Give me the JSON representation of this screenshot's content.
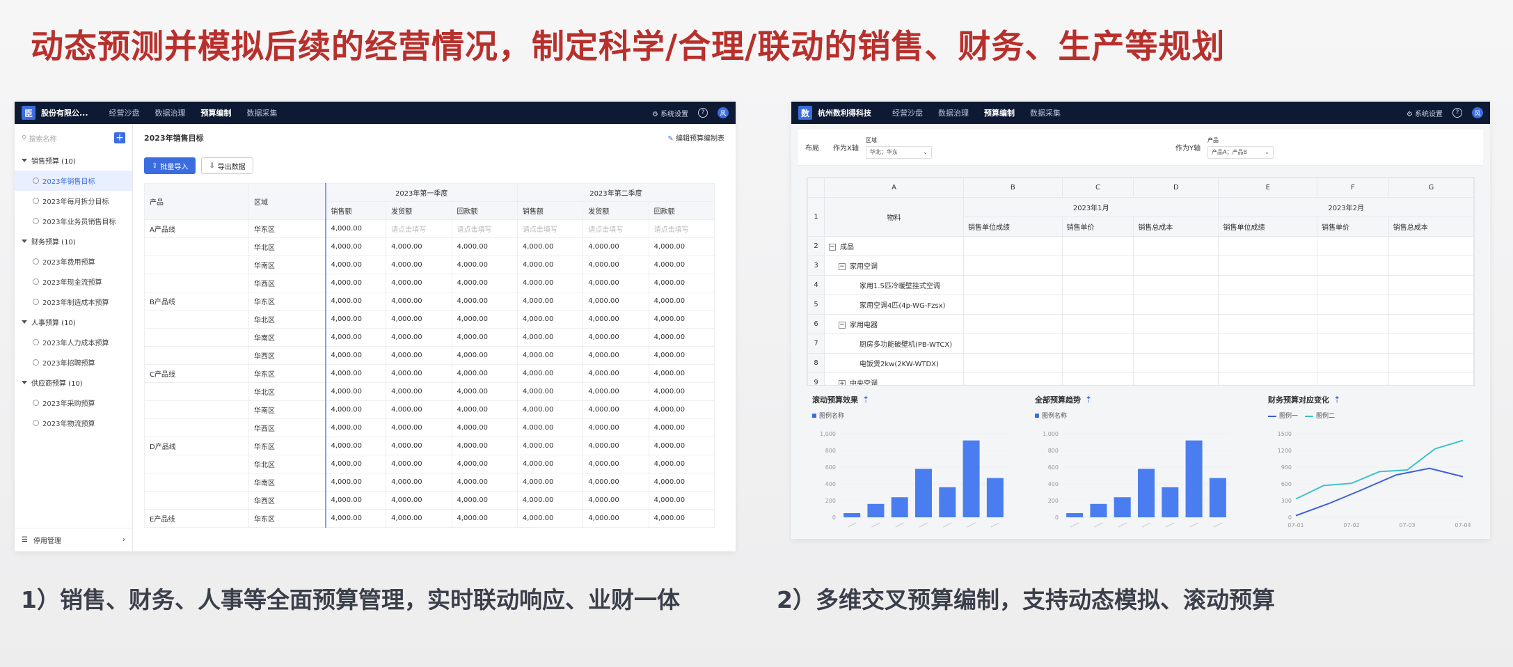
{
  "headline": "动态预测并模拟后续的经营情况，制定科学/合理/联动的销售、财务、生产等规划",
  "captions": {
    "left": "1）销售、财务、人事等全面预算管理，实时联动响应、业财一体",
    "right": "2）多维交叉预算编制，支持动态模拟、滚动预算"
  },
  "left": {
    "company": "股份有限公...",
    "nav": [
      "经营沙盘",
      "数据治理",
      "预算编制",
      "数据采集"
    ],
    "settings": "系统设置",
    "avatar": "风",
    "search": "搜索名称",
    "tree": [
      {
        "group": "销售预算 (10)",
        "items": [
          "2023年销售目标",
          "2023年每月拆分目标",
          "2023年业务员销售目标"
        ]
      },
      {
        "group": "财务预算 (10)",
        "items": [
          "2023年费用预算",
          "2023年现金流预算",
          "2023年制造成本预算"
        ]
      },
      {
        "group": "人事预算 (10)",
        "items": [
          "2023年人力成本预算",
          "2023年招聘预算"
        ]
      },
      {
        "group": "供应商预算 (10)",
        "items": [
          "2023年采购预算",
          "2023年物流预算"
        ]
      }
    ],
    "footer": "停用管理",
    "title": "2023年销售目标",
    "edit": "编辑预算编制表",
    "import": "批量导入",
    "export": "导出数据",
    "q1": "2023年第一季度",
    "q2": "2023年第二季度",
    "col_product": "产品",
    "col_region": "区域",
    "cols": [
      "销售额",
      "发货额",
      "回款额",
      "销售额",
      "发货额",
      "回款额"
    ],
    "placeholder": "请点击填写",
    "value": "4,000.00",
    "rows": [
      [
        "A产品线",
        "华东区"
      ],
      [
        "",
        "华北区"
      ],
      [
        "",
        "华南区"
      ],
      [
        "",
        "华西区"
      ],
      [
        "B产品线",
        "华东区"
      ],
      [
        "",
        "华北区"
      ],
      [
        "",
        "华南区"
      ],
      [
        "",
        "华西区"
      ],
      [
        "C产品线",
        "华东区"
      ],
      [
        "",
        "华北区"
      ],
      [
        "",
        "华南区"
      ],
      [
        "",
        "华西区"
      ],
      [
        "D产品线",
        "华东区"
      ],
      [
        "",
        "华北区"
      ],
      [
        "",
        "华南区"
      ],
      [
        "",
        "华西区"
      ],
      [
        "E产品线",
        "华东区"
      ]
    ]
  },
  "right": {
    "logo": "数",
    "company": "杭州数利得科技",
    "nav": [
      "经营沙盘",
      "数据治理",
      "预算编制",
      "数据采集"
    ],
    "settings": "系统设置",
    "avatar": "风",
    "layout": "布局",
    "x_axis": "作为X轴",
    "region": "区域",
    "region_val": "华北；华东",
    "y_axis": "作为Y轴",
    "product": "产品",
    "product_val": "产品A；产品B",
    "cols": [
      "A",
      "B",
      "C",
      "D",
      "E",
      "F",
      "G"
    ],
    "month1": "2023年1月",
    "month2": "2023年2月",
    "material": "物料",
    "subcols": [
      "销售单位成绩",
      "销售单价",
      "销售总成本",
      "销售单位成绩",
      "销售单价",
      "销售总成本"
    ],
    "rows": [
      {
        "n": "2",
        "label": "成品",
        "level": 0,
        "box": "−"
      },
      {
        "n": "3",
        "label": "家用空调",
        "level": 1,
        "box": "−"
      },
      {
        "n": "4",
        "label": "家用1.5匹冷暖壁挂式空调",
        "level": 2,
        "box": ""
      },
      {
        "n": "5",
        "label": "家用空调4匹(4p-WG-Fzsx)",
        "level": 2,
        "box": ""
      },
      {
        "n": "6",
        "label": "家用电器",
        "level": 1,
        "box": "−"
      },
      {
        "n": "7",
        "label": "厨房多功能破壁机(PB-WTCX)",
        "level": 2,
        "box": ""
      },
      {
        "n": "8",
        "label": "电饭煲2kw(2KW-WTDX)",
        "level": 2,
        "box": ""
      },
      {
        "n": "9",
        "label": "中央空调",
        "level": 1,
        "box": "+"
      }
    ],
    "charts": [
      {
        "title": "滚动预算效果",
        "legend": "图例名称"
      },
      {
        "title": "全部预算趋势",
        "legend": "图例名称"
      },
      {
        "title": "财务预算对应变化",
        "legend1": "图例一",
        "legend2": "图例二"
      }
    ]
  },
  "chart_data": [
    {
      "type": "bar",
      "title": "滚动预算效果",
      "series": [
        {
          "name": "图例名称",
          "values": [
            50,
            160,
            240,
            580,
            360,
            920,
            470
          ]
        }
      ],
      "yticks": [
        "0",
        "200",
        "400",
        "600",
        "800",
        "1,000"
      ],
      "ylim": [
        0,
        1000
      ],
      "color": "#4a7ef0"
    },
    {
      "type": "bar",
      "title": "全部预算趋势",
      "series": [
        {
          "name": "图例名称",
          "values": [
            50,
            160,
            240,
            580,
            360,
            920,
            470
          ]
        }
      ],
      "yticks": [
        "0",
        "200",
        "400",
        "600",
        "800",
        "1,000"
      ],
      "ylim": [
        0,
        1000
      ],
      "color": "#4a7ef0"
    },
    {
      "type": "line",
      "title": "财务预算对应变化",
      "categories": [
        "07-01",
        "07-02",
        "07-03",
        "07-04"
      ],
      "series": [
        {
          "name": "图例一",
          "values": [
            30,
            250,
            500,
            760,
            880,
            730
          ],
          "color": "#3b5fe0"
        },
        {
          "name": "图例二",
          "values": [
            330,
            570,
            610,
            820,
            850,
            1230,
            1380
          ],
          "color": "#3cc2c9"
        }
      ],
      "yticks": [
        "0",
        "300",
        "600",
        "900",
        "1200",
        "1500"
      ],
      "ylim": [
        0,
        1500
      ]
    }
  ]
}
